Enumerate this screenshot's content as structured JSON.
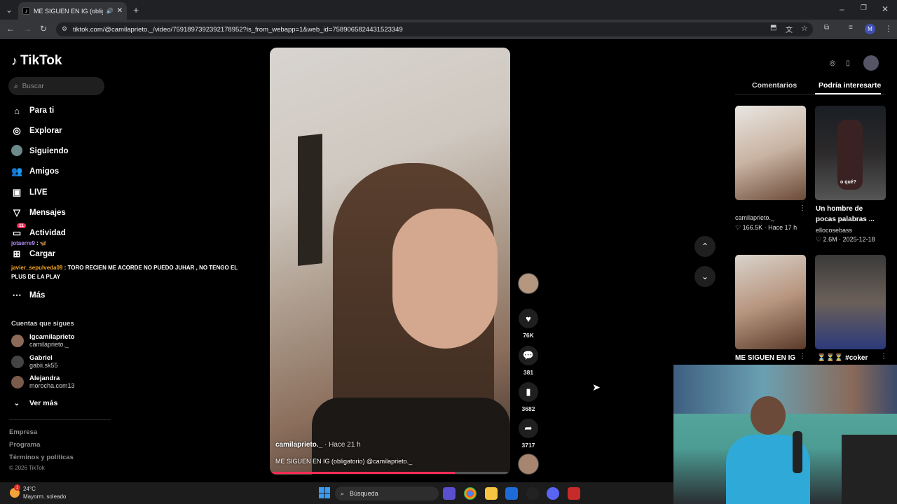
{
  "browser": {
    "tab_title": "ME SIGUEN EN IG (obligat",
    "new_tab": "+",
    "url": "tiktok.com/@camilaprieto._/video/7591897392392178952?is_from_webapp=1&web_id=7589065824431523349"
  },
  "sidebar": {
    "logo": "TikTok",
    "search_placeholder": "Buscar",
    "nav": [
      {
        "label": "Para ti",
        "icon": "home-icon"
      },
      {
        "label": "Explorar",
        "icon": "compass-icon"
      },
      {
        "label": "Siguiendo",
        "icon": "following-avatar-icon"
      },
      {
        "label": "Amigos",
        "icon": "friends-icon"
      },
      {
        "label": "LIVE",
        "icon": "live-icon"
      },
      {
        "label": "Mensajes",
        "icon": "messages-icon"
      },
      {
        "label": "Actividad",
        "icon": "activity-icon",
        "badge": "11"
      },
      {
        "label": "Cargar",
        "icon": "upload-icon"
      },
      {
        "label": "Más",
        "icon": "more-icon"
      }
    ],
    "following_label": "Cuentas que sigues",
    "accounts": [
      {
        "name": "Igcamilaprieto",
        "handle": "camilaprieto._"
      },
      {
        "name": "Gabriel",
        "handle": "gabii.sk55"
      },
      {
        "name": "Alejandra",
        "handle": "morocha.com13"
      }
    ],
    "see_more": "Ver más",
    "footer": [
      "Empresa",
      "Programa",
      "Términos y políticas",
      "© 2026 TikTok"
    ]
  },
  "chat": [
    {
      "user": "jotaerre9",
      "text": " : 🦋"
    },
    {
      "user": "javier_sepulveda09",
      "text": " : TORO RECIEN ME ACORDE NO PUEDO JUHAR , NO TENGO EL PLUS DE LA PLAY"
    }
  ],
  "video": {
    "author": "camilaprieto._",
    "time": " · Hace 21 h",
    "caption": "ME SIGUEN EN IG (obligatorio) @camilaprieto._",
    "progress": 0.77
  },
  "actions": {
    "likes": "76K",
    "comments": "381",
    "saves": "3682",
    "shares": "3717"
  },
  "right_panel": {
    "tabs": [
      "Comentarios",
      "Podría interesarte"
    ],
    "videos": [
      {
        "title": "",
        "user": "camilaprieto._",
        "likes": "166.5K",
        "date": "Hace 17 h"
      },
      {
        "title": "Un hombre de pocas palabras ...",
        "user": "ellocosebass",
        "likes": "2.6M",
        "date": "2025-12-18",
        "overlay": "o qué?"
      },
      {
        "title": "ME SIGUEN EN IG",
        "user": "",
        "likes": "",
        "date": ""
      },
      {
        "title": "⏳⏳⏳ #coker",
        "user": "",
        "likes": "",
        "date": ""
      }
    ]
  },
  "taskbar": {
    "temp": "24°C",
    "weather": "Mayorm. soleado",
    "search": "Búsqueda",
    "alert_badge": "1"
  },
  "colors": {
    "accent": "#fe2c55",
    "background": "#000000"
  }
}
